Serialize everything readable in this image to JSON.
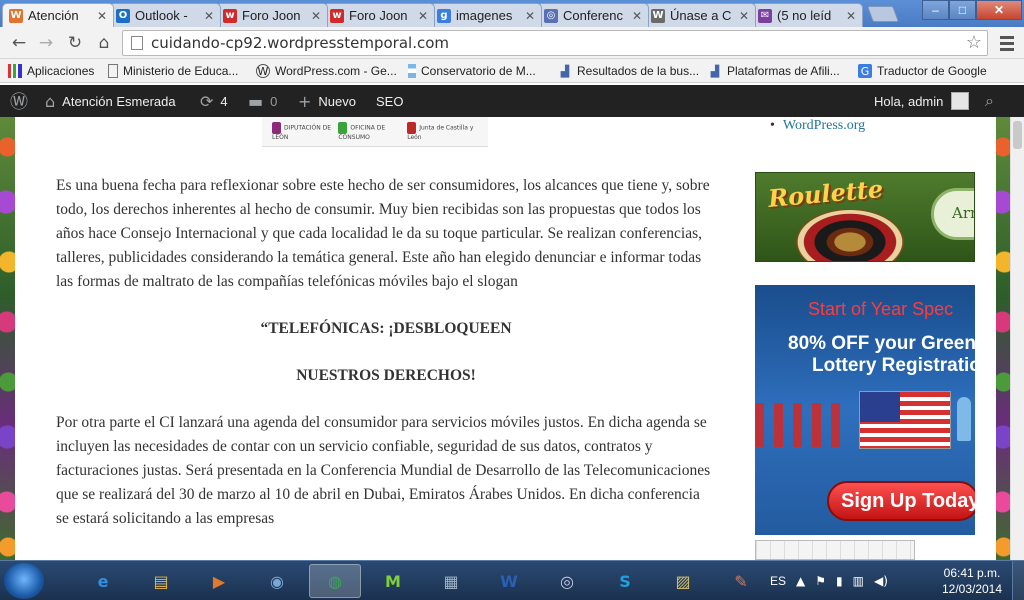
{
  "browser": {
    "tabs": [
      {
        "label": "Atención",
        "icon": "wordpress-icon",
        "color": "#e2722f",
        "glyph": "W",
        "active": true
      },
      {
        "label": "Outlook -",
        "icon": "outlook-icon",
        "color": "#1a6fc4",
        "glyph": "O",
        "active": false
      },
      {
        "label": "Foro Joon",
        "icon": "w-brand-icon",
        "color": "#d22a2a",
        "glyph": "w",
        "active": false
      },
      {
        "label": "Foro Joon",
        "icon": "w-brand-icon",
        "color": "#d22a2a",
        "glyph": "w",
        "active": false
      },
      {
        "label": "imagenes",
        "icon": "google-icon",
        "color": "#3b7de0",
        "glyph": "g",
        "active": false
      },
      {
        "label": "Conferenc",
        "icon": "globe-icon",
        "color": "#5b6fb3",
        "glyph": "◎",
        "active": false
      },
      {
        "label": "Únase a C",
        "icon": "wordpress-icon",
        "color": "#6a6a6a",
        "glyph": "W",
        "active": false
      },
      {
        "label": "(5 no leíd",
        "icon": "mail-icon",
        "color": "#7b3fa0",
        "glyph": "✉",
        "active": false
      }
    ],
    "url": "cuidando-cp92.wordpresstemporal.com"
  },
  "bookmarks": [
    {
      "label": "Aplicaciones",
      "icon": "apps-grid-icon"
    },
    {
      "label": "Ministerio de Educa...",
      "icon": "page-icon"
    },
    {
      "label": "WordPress.com - Ge...",
      "icon": "wordpress-icon"
    },
    {
      "label": "Conservatorio de M...",
      "icon": "argentina-flag-icon"
    },
    {
      "label": "Resultados de la bus...",
      "icon": "chart-icon"
    },
    {
      "label": "Plataformas de Afili...",
      "icon": "chart-icon"
    },
    {
      "label": "Traductor de Google",
      "icon": "translate-icon"
    }
  ],
  "adminbar": {
    "site_name": "Atención Esmerada",
    "updates_count": "4",
    "comments_count": "0",
    "new_label": "Nuevo",
    "seo_label": "SEO",
    "greeting": "Hola, admin"
  },
  "logo_strip": {
    "item1": "DIPUTACIÓN DE LEÓN",
    "item2": "OFICINA DE CONSUMO",
    "item3": "Junta de Castilla y León"
  },
  "article": {
    "paragraph1": "Es una buena fecha para reflexionar sobre este hecho de ser consumidores, los alcances que tiene y, sobre todo, los derechos inherentes al hecho de consumir. Muy bien recibidas son las propuestas que todos los años hace Consejo Internacional y que cada localidad le da su toque particular. Se realizan conferencias, talleres, publicidades considerando la temática general. Este año han elegido denunciar e informar todas las formas de maltrato de las compañías telefónicas móviles bajo el slogan",
    "slogan_line1": "“TELEFÓNICAS: ¡DESBLOQUEEN",
    "slogan_line2": "NUESTROS DERECHOS!",
    "paragraph2": "Por otra parte el CI lanzará una agenda del consumidor para servicios móviles justos. En dicha agenda se incluyen las necesidades de contar con un servicio confiable, seguridad de sus datos, contratos y facturaciones justas. Será presentada en la Conferencia Mundial de Desarrollo de las Telecomunicaciones que se realizará del 30 de marzo al 10 de abril en Dubai, Emiratos Árabes Unidos. En dicha conferencia se estará solicitando a las empresas"
  },
  "sidebar": {
    "link": "WordPress.org",
    "ad_roulette": {
      "title": "Roulette",
      "button": "Arr"
    },
    "ad_lottery": {
      "headline": "Start of Year Spec",
      "line1": "80% OFF your Green",
      "line2": "Lottery Registratio",
      "button": "Sign Up Today"
    }
  },
  "taskbar": {
    "apps": [
      {
        "name": "internet-explorer-icon",
        "glyph": "e",
        "color": "#2f8fe0"
      },
      {
        "name": "file-explorer-icon",
        "glyph": "▤",
        "color": "#e6b84a"
      },
      {
        "name": "media-player-icon",
        "glyph": "▶",
        "color": "#e07a2a"
      },
      {
        "name": "webcam-icon",
        "glyph": "◉",
        "color": "#7aa7d6"
      },
      {
        "name": "chrome-icon",
        "glyph": "◍",
        "color": "#3aa757",
        "active": true
      },
      {
        "name": "movistar-icon",
        "glyph": "M",
        "color": "#7fcf3a"
      },
      {
        "name": "calculator-icon",
        "glyph": "▦",
        "color": "#9fb3c8"
      },
      {
        "name": "word-icon",
        "glyph": "W",
        "color": "#2b5fb4"
      },
      {
        "name": "disc-icon",
        "glyph": "◎",
        "color": "#c8c8e8"
      },
      {
        "name": "skype-icon",
        "glyph": "S",
        "color": "#1ea0e0"
      },
      {
        "name": "image-viewer-icon",
        "glyph": "▨",
        "color": "#d9c26a"
      },
      {
        "name": "draw-icon",
        "glyph": "✎",
        "color": "#e8754a"
      }
    ],
    "language": "ES",
    "time": "06:41 p.m.",
    "date": "12/03/2014"
  }
}
